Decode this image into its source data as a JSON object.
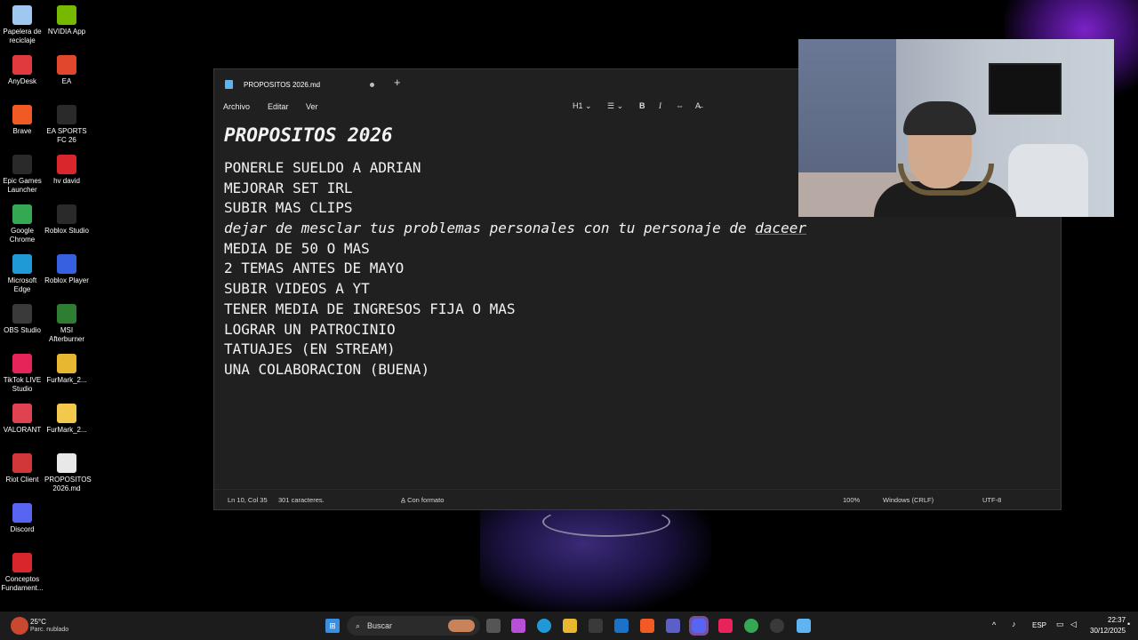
{
  "desktop": {
    "icons_col1": [
      {
        "label": "Papelera de reciclaje",
        "icon": "recycle-bin-icon",
        "color": "#9fc7f0"
      },
      {
        "label": "AnyDesk",
        "icon": "anydesk-icon",
        "color": "#e0393e"
      },
      {
        "label": "Brave",
        "icon": "brave-icon",
        "color": "#f25a24"
      },
      {
        "label": "Epic Games Launcher",
        "icon": "epic-games-icon",
        "color": "#2a2a2a"
      },
      {
        "label": "Google Chrome",
        "icon": "chrome-icon",
        "color": "#34a853"
      },
      {
        "label": "Microsoft Edge",
        "icon": "edge-icon",
        "color": "#1f9ad6"
      },
      {
        "label": "OBS Studio",
        "icon": "obs-icon",
        "color": "#3a3a3a"
      },
      {
        "label": "TikTok LIVE Studio",
        "icon": "tiktok-icon",
        "color": "#e6245a"
      },
      {
        "label": "VALORANT",
        "icon": "valorant-icon",
        "color": "#e04350"
      },
      {
        "label": "Riot Client",
        "icon": "riot-icon",
        "color": "#d13639"
      },
      {
        "label": "Discord",
        "icon": "discord-icon",
        "color": "#5865f2"
      },
      {
        "label": "Conceptos Fundament...",
        "icon": "pdf-icon",
        "color": "#d9262c"
      }
    ],
    "icons_col2": [
      {
        "label": "NVIDIA App",
        "icon": "nvidia-icon",
        "color": "#76b900"
      },
      {
        "label": "EA",
        "icon": "ea-icon",
        "color": "#e0472d"
      },
      {
        "label": "EA SPORTS FC 26",
        "icon": "ea-sports-icon",
        "color": "#2a2a2a"
      },
      {
        "label": "hv david",
        "icon": "pdf-icon",
        "color": "#d9262c"
      },
      {
        "label": "Roblox Studio",
        "icon": "roblox-studio-icon",
        "color": "#2a2a2a"
      },
      {
        "label": "Roblox Player",
        "icon": "roblox-player-icon",
        "color": "#3560e0"
      },
      {
        "label": "MSI Afterburner",
        "icon": "msi-afterburner-icon",
        "color": "#2d7d32"
      },
      {
        "label": "FurMark_2...",
        "icon": "folder-icon",
        "color": "#e8b730"
      },
      {
        "label": "FurMark_2...",
        "icon": "folder-icon",
        "color": "#f2c94c"
      },
      {
        "label": "PROPOSITOS 2026.md",
        "icon": "file-icon",
        "color": "#e8e8e8"
      }
    ]
  },
  "notepad": {
    "tab_title": "PROPOSITOS 2026.md",
    "new_tab": "+",
    "menu": [
      "Archivo",
      "Editar",
      "Ver"
    ],
    "format_toolbar": {
      "heading": "H1",
      "list": "☰",
      "bold": "B",
      "italic": "I",
      "link": "⇔",
      "clear": "A̶"
    },
    "heading": "PROPOSITOS 2026",
    "lines": [
      "PONERLE SUELDO A ADRIAN",
      "MEJORAR SET IRL",
      "SUBIR MAS CLIPS",
      "MEDIA DE 50 O MAS",
      "2 TEMAS ANTES DE MAYO",
      "SUBIR VIDEOS A YT",
      "TENER MEDIA DE INGRESOS FIJA O MAS",
      "LOGRAR UN PATROCINIO",
      "TATUAJES (EN STREAM)",
      "UNA COLABORACION (BUENA)"
    ],
    "italic_line": {
      "prefix": "dejar de mesclar tus problemas personales con tu personaje de ",
      "misspelled": "daceer"
    },
    "status": {
      "position": "Ln 10, Col 35",
      "chars": "301 caracteres.",
      "format": "Con formato",
      "zoom": "100%",
      "line_ending": "Windows (CRLF)",
      "encoding": "UTF-8"
    }
  },
  "taskbar": {
    "weather_temp": "25°C",
    "weather_desc": "Parc. nublado",
    "search_placeholder": "Buscar",
    "lang": "ESP",
    "time": "22:37",
    "date": "30/12/2025"
  },
  "colors": {
    "window_bg": "#202020",
    "accent": "#5fb3f0",
    "taskbar_bg": "#1c1c1c"
  }
}
